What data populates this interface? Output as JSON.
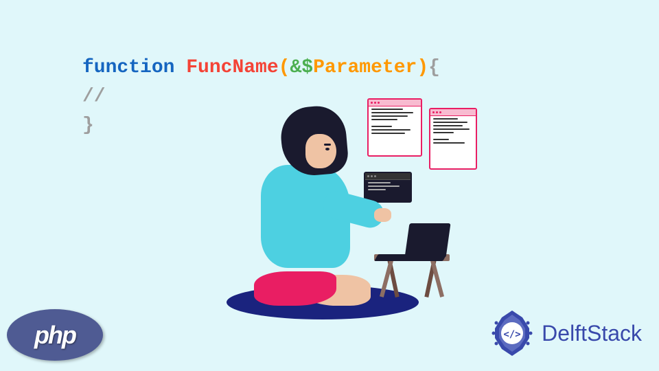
{
  "code": {
    "keyword": "function",
    "name": "FuncName",
    "paren_open": "(",
    "amp": "&",
    "dollar": "$",
    "param": "Parameter",
    "paren_close": ")",
    "brace_open": "{",
    "comment": "//",
    "brace_close": "}"
  },
  "logos": {
    "php": "php",
    "delftstack": "DelftStack"
  }
}
